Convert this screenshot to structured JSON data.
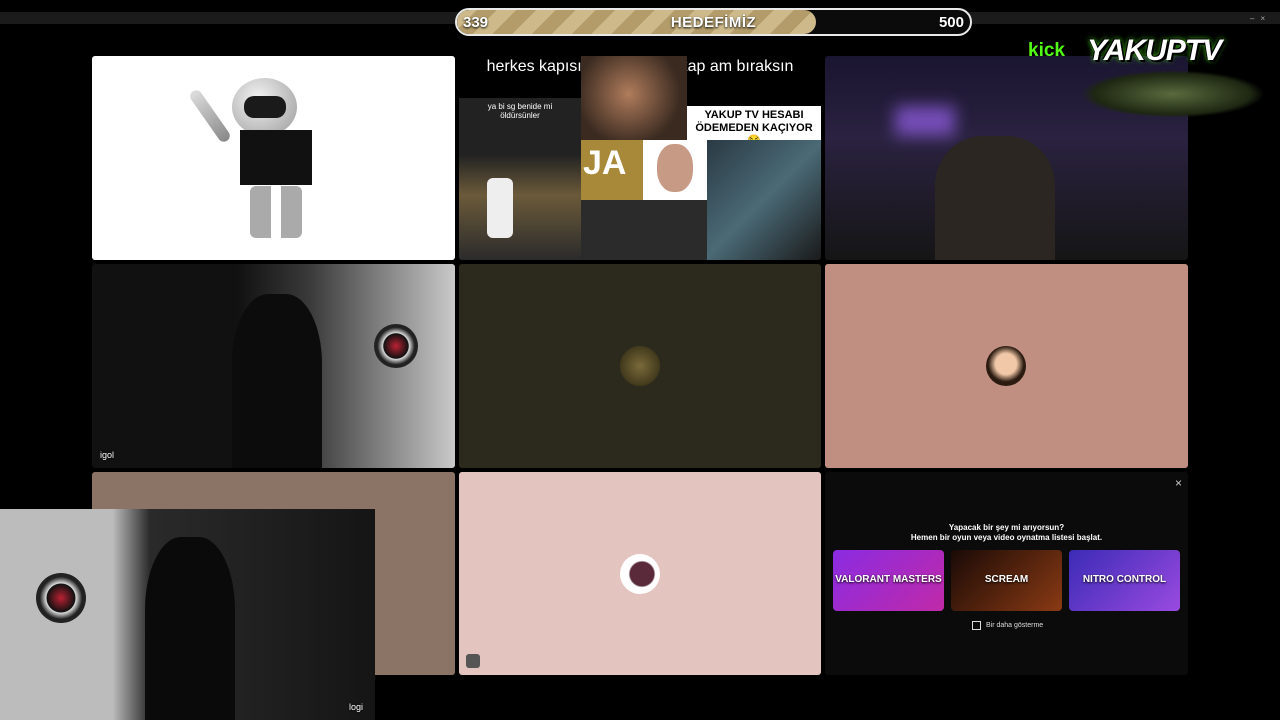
{
  "goal": {
    "start": "339",
    "title": "HEDEFİMİZ",
    "end": "500",
    "progress": 0.7
  },
  "brand": {
    "kick": "kick",
    "name": "YAKUPTV"
  },
  "window_controls": {
    "minimize": "–",
    "close": "×"
  },
  "tiles": {
    "robot": {
      "name": ""
    },
    "meme": {
      "caption": "herkes kapısının önüne bir kap am bıraksın",
      "left_text": "ya bi sg benide mi öldürsünler",
      "banner_line1": "YAKUP TV HESABI",
      "banner_line2": "ÖDEMEDEN KAÇIYOR 😂",
      "ja": "JA"
    },
    "cam_top_right": {
      "name": ""
    },
    "igol": {
      "name": "igol"
    },
    "avatar_dark": {
      "name": ""
    },
    "avatar_pink": {
      "name": ""
    },
    "empty_tan": {
      "name": ""
    },
    "avatar_light": {
      "name": ""
    }
  },
  "game_panel": {
    "title_line1": "Yapacak bir şey mi arıyorsun?",
    "title_line2": "Hemen bir oyun veya video oynatma listesi başlat.",
    "games": [
      {
        "label": "VALORANT MASTERS",
        "color": "#7b2cbf"
      },
      {
        "label": "SCREAM",
        "color": "#5a1a10"
      },
      {
        "label": "NITRO CONTROL",
        "color": "#5b3bd6"
      }
    ],
    "dont_show": "Bir daha gösterme",
    "close": "×"
  },
  "pip": {
    "name": "logi"
  }
}
